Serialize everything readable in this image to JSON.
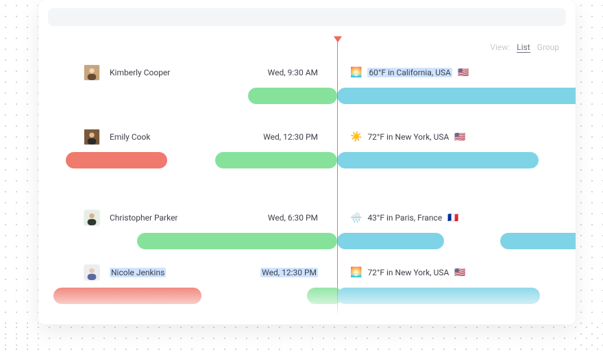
{
  "view": {
    "label": "View:",
    "list": "List",
    "group": "Group",
    "active": "list"
  },
  "rows": [
    {
      "name": "Kimberly Cooper",
      "time": "Wed, 9:30 AM",
      "wx_icon": "🌅",
      "weather": "60°F in California, USA",
      "flag": "🇺🇸",
      "selected": {
        "name": false,
        "time": false,
        "weather": true
      }
    },
    {
      "name": "Emily Cook",
      "time": "Wed, 12:30 PM",
      "wx_icon": "☀️",
      "weather": "72°F in New York, USA",
      "flag": "🇺🇸",
      "selected": {
        "name": false,
        "time": false,
        "weather": false
      }
    },
    {
      "name": "Christopher Parker",
      "time": "Wed, 6:30 PM",
      "wx_icon": "🌧️",
      "weather": "43°F in Paris, France",
      "flag": "🇫🇷",
      "selected": {
        "name": false,
        "time": false,
        "weather": false
      }
    },
    {
      "name": "Nicole Jenkins",
      "time": "Wed, 12:30 PM",
      "wx_icon": "🌅",
      "weather": "72°F in New York, USA",
      "flag": "🇺🇸",
      "selected": {
        "name": true,
        "time": true,
        "weather": false
      }
    }
  ]
}
